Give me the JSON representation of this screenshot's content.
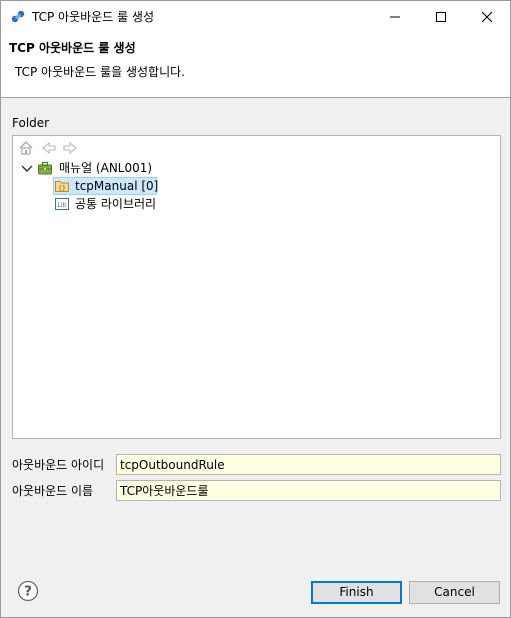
{
  "window": {
    "title": "TCP 아웃바운드 룰 생성"
  },
  "banner": {
    "heading": "TCP 아웃바운드 룰 생성",
    "description": "TCP 아웃바운드 룰을 생성합니다."
  },
  "folder": {
    "label": "Folder",
    "tree": {
      "root": {
        "label": "매뉴얼  (ANL001)",
        "expanded": true,
        "icon": "briefcase-icon"
      },
      "children": [
        {
          "label": "tcpManual [0]",
          "icon": "folder-icon",
          "selected": true
        },
        {
          "label": "공통 라이브러리",
          "icon": "library-icon",
          "selected": false
        }
      ]
    }
  },
  "fields": {
    "outbound_id": {
      "label": "아웃바운드 아이디",
      "value": "tcpOutboundRule"
    },
    "outbound_name": {
      "label": "아웃바운드 이름",
      "value": "TCP아웃바운드룰"
    }
  },
  "buttons": {
    "finish": "Finish",
    "cancel": "Cancel"
  },
  "colors": {
    "input_bg": "#ffffe1",
    "selection_bg": "#cce8ff",
    "default_button_border": "#0078d7"
  }
}
